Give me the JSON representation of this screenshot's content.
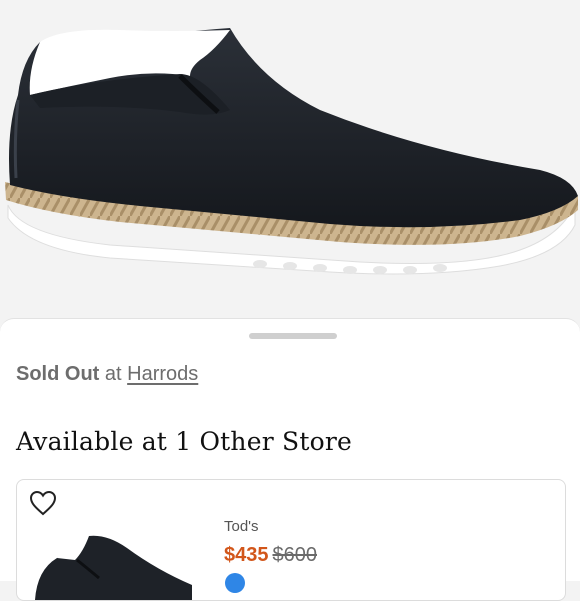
{
  "listing": {
    "status": "Sold Out",
    "at_word": "at",
    "retailer": "Harrods"
  },
  "other_stores": {
    "title": "Available at 1 Other Store",
    "offers": [
      {
        "brand": "Tod's",
        "sale_price": "$435",
        "original_price": "$600"
      }
    ]
  },
  "colors": {
    "sale_price": "#d2561a",
    "badge": "#2f86e6"
  },
  "icons": {
    "favorite": "heart-outline-icon"
  }
}
